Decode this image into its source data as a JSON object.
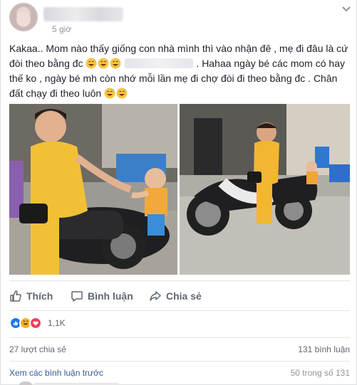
{
  "post": {
    "timestamp": "5 giờ",
    "text_part1": "Kakaa.. Mom nào thấy giống con nhà mình thì vào nhận đê , mẹ đi đâu là cứ đòi theo bằng đc",
    "text_part2": ". Hahaa ngày bé các mom có hay thế ko , ngày bé mh còn nhớ mỗi lần mẹ đi chợ đòi đi theo bằng đc . Chân đất chạy đi theo luôn",
    "emoji": "grinning-face-with-sweat"
  },
  "actions": {
    "like": "Thích",
    "comment": "Bình luận",
    "share": "Chia sẻ"
  },
  "reactions": {
    "types": [
      "like",
      "haha",
      "love"
    ],
    "count": "1,1K"
  },
  "stats": {
    "shares": "27 lượt chia sẻ",
    "comments": "131 bình luận"
  },
  "comments_section": {
    "view_previous": "Xem các bình luận trước",
    "count_label": "50 trong số 131"
  },
  "colors": {
    "link": "#385898",
    "secondary_text": "#606770",
    "like_blue": "#1877f2",
    "love_red": "#f33e58",
    "haha_yellow": "#f7b125"
  }
}
